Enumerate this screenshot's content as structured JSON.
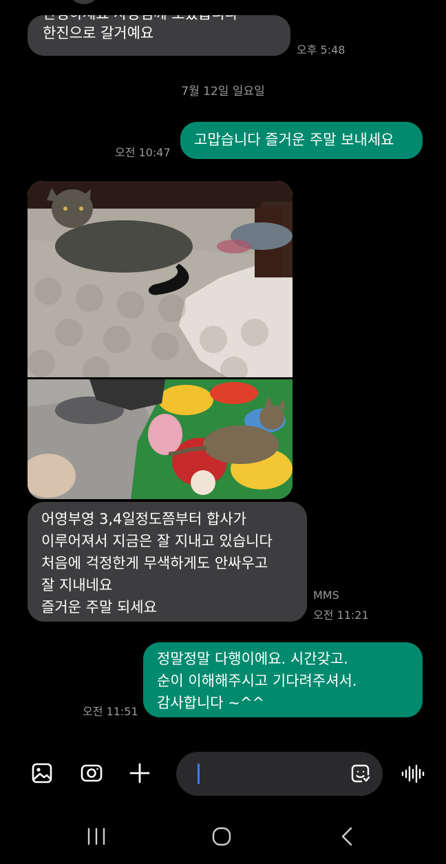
{
  "messages": [
    {
      "id": "msg-1",
      "direction": "incoming",
      "lines": [
        "안녕하세요 사장님께 보았습니다",
        "한진으로 갈거예요"
      ],
      "time": "오후 5:48"
    },
    {
      "id": "msg-2",
      "direction": "outgoing",
      "lines": [
        "고맙습니다 즐거운 주말 보내세요"
      ],
      "time": "오전 10:47"
    },
    {
      "id": "msg-3",
      "direction": "incoming",
      "lines": [
        "어영부영 3,4일정도쯤부터 합사가",
        "이루어져서 지금은 잘 지내고 있습니다",
        "처음에 걱정한게 무색하게도 안싸우고",
        "잘 지내네요",
        "즐거운 주말 되세요"
      ],
      "type_label": "MMS",
      "time": "오전 11:21"
    },
    {
      "id": "msg-4",
      "direction": "outgoing",
      "lines": [
        "정말정말 다행이에요.  시간갖고.",
        "순이 이해해주시고 기다려주셔서.",
        "감사합니다 ~^^"
      ],
      "time": "오전 11:51"
    }
  ],
  "date_separator": "7월 12일 일요일",
  "composer": {
    "input_value": "",
    "icons": [
      "gallery-icon",
      "camera-icon",
      "plus-icon",
      "sticker-icon",
      "voice-icon"
    ]
  },
  "nav": {
    "icons": [
      "recents-icon",
      "home-icon",
      "back-icon"
    ]
  },
  "colors": {
    "background": "#000000",
    "incoming_bubble": "#3d3d3f",
    "outgoing_bubble": "#028a6e",
    "timestamp": "#9a9a9a",
    "caret": "#3d7bff"
  }
}
